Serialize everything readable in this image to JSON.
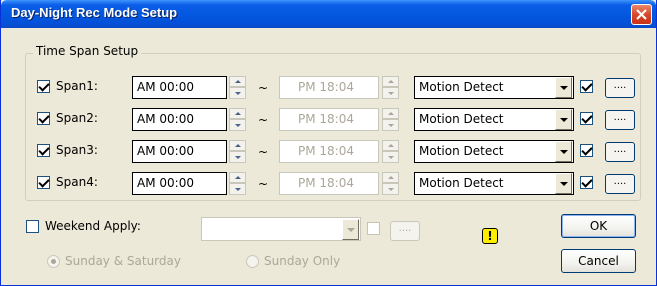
{
  "window": {
    "title": "Day-Night Rec Mode Setup"
  },
  "time_span": {
    "legend": "Time Span Setup",
    "spans": [
      {
        "label": "Span1:",
        "enabled": true,
        "start": "AM 00:00",
        "separator": "~",
        "end": "PM 18:04",
        "end_enabled": false,
        "mode": "Motion Detect",
        "mode_checked": true,
        "more_label": "...."
      },
      {
        "label": "Span2:",
        "enabled": true,
        "start": "AM 00:00",
        "separator": "~",
        "end": "PM 18:04",
        "end_enabled": false,
        "mode": "Motion Detect",
        "mode_checked": true,
        "more_label": "...."
      },
      {
        "label": "Span3:",
        "enabled": true,
        "start": "AM 00:00",
        "separator": "~",
        "end": "PM 18:04",
        "end_enabled": false,
        "mode": "Motion Detect",
        "mode_checked": true,
        "more_label": "...."
      },
      {
        "label": "Span4:",
        "enabled": true,
        "start": "AM 00:00",
        "separator": "~",
        "end": "PM 18:04",
        "end_enabled": false,
        "mode": "Motion Detect",
        "mode_checked": true,
        "more_label": "...."
      }
    ]
  },
  "weekend": {
    "label": "Weekend Apply:",
    "checked": false,
    "mode_value": "",
    "more_label": "....",
    "options": [
      {
        "label": "Sunday & Saturday",
        "selected": true
      },
      {
        "label": "Sunday Only",
        "selected": false
      }
    ]
  },
  "buttons": {
    "ok": "OK",
    "cancel": "Cancel"
  },
  "icons": {
    "warning": "!"
  }
}
